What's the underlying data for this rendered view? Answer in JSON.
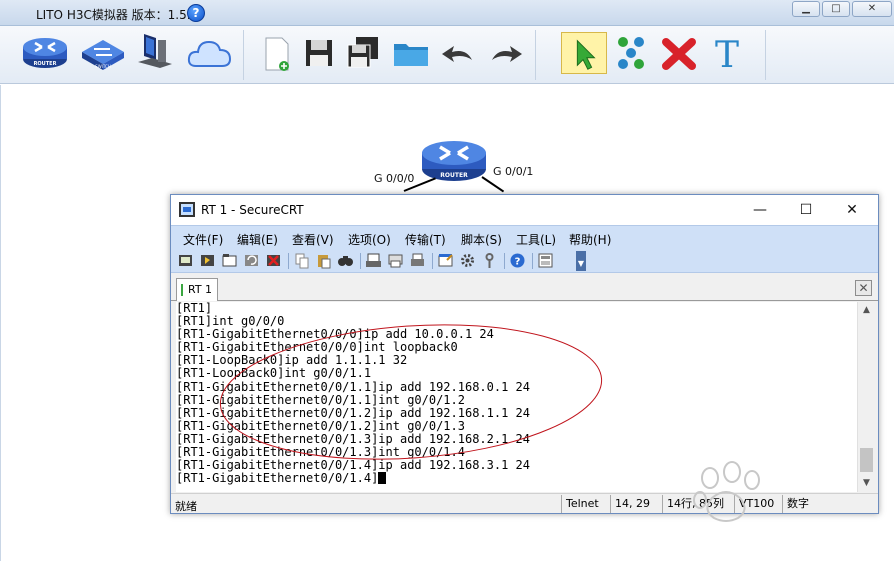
{
  "app": {
    "title": "LITO H3C模拟器 版本：1.5.2",
    "help_glyph": "?",
    "window_controls": {
      "minimize": "▁",
      "maximize": "□",
      "close": "✕"
    }
  },
  "toolbar": {
    "buttons": [
      {
        "name": "router-tool",
        "label": "ROUTER"
      },
      {
        "name": "switch-tool",
        "label": "SWITCH"
      },
      {
        "name": "pc-tool",
        "label": ""
      },
      {
        "name": "cloud-tool",
        "label": ""
      },
      {
        "name": "new-file",
        "label": ""
      },
      {
        "name": "save",
        "label": ""
      },
      {
        "name": "save-as",
        "label": ""
      },
      {
        "name": "open-folder",
        "label": ""
      },
      {
        "name": "undo",
        "label": ""
      },
      {
        "name": "redo",
        "label": ""
      },
      {
        "name": "select-pointer",
        "label": ""
      },
      {
        "name": "connect",
        "label": ""
      },
      {
        "name": "delete",
        "label": ""
      },
      {
        "name": "text",
        "label": "T"
      }
    ]
  },
  "topology": {
    "router_label": "ROUTER",
    "ports": {
      "left": "G 0/0/0",
      "right": "G 0/0/1"
    }
  },
  "securecrt": {
    "title": "RT 1 - SecureCRT",
    "controls": {
      "minimize": "—",
      "maximize": "☐",
      "close": "✕"
    },
    "menu": [
      "文件(F)",
      "编辑(E)",
      "查看(V)",
      "选项(O)",
      "传输(T)",
      "脚本(S)",
      "工具(L)",
      "帮助(H)"
    ],
    "tab": {
      "label": "RT 1",
      "close_glyph": "✕"
    },
    "terminal_lines": [
      "[RT1]",
      "[RT1]int g0/0/0",
      "[RT1-GigabitEthernet0/0/0]ip add 10.0.0.1 24",
      "[RT1-GigabitEthernet0/0/0]int loopback0",
      "[RT1-LoopBack0]ip add 1.1.1.1 32",
      "[RT1-LoopBack0]int g0/0/1.1",
      "[RT1-GigabitEthernet0/0/1.1]ip add 192.168.0.1 24",
      "[RT1-GigabitEthernet0/0/1.1]int g0/0/1.2",
      "[RT1-GigabitEthernet0/0/1.2]ip add 192.168.1.1 24",
      "[RT1-GigabitEthernet0/0/1.2]int g0/0/1.3",
      "[RT1-GigabitEthernet0/0/1.3]ip add 192.168.2.1 24",
      "[RT1-GigabitEthernet0/0/1.3]int g0/0/1.4",
      "[RT1-GigabitEthernet0/0/1.4]ip add 192.168.3.1 24",
      "[RT1-GigabitEthernet0/0/1.4]"
    ],
    "scroll": {
      "up": "▲",
      "down": "▼"
    },
    "status": {
      "ready": "就绪",
      "protocol": "Telnet",
      "position": "14,  29",
      "size": "14行, 85列",
      "emulation": "VT100",
      "caps": "数字"
    }
  },
  "colors": {
    "accent": "#2a6ad1",
    "annotation": "#c0141c",
    "menubar": "#cfe0f7"
  }
}
